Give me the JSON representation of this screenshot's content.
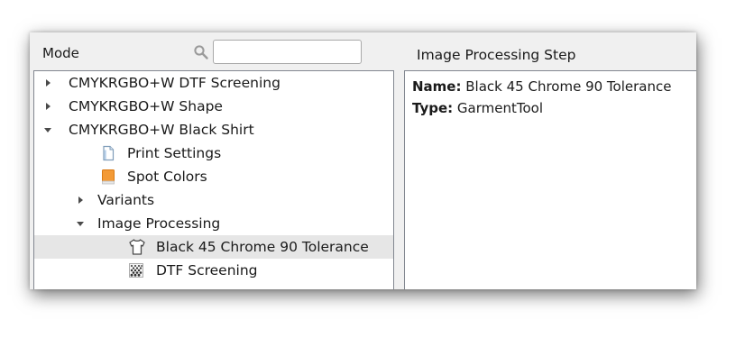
{
  "mode_panel": {
    "label": "Mode",
    "search": {
      "icon": "search-icon",
      "value": "",
      "placeholder": ""
    },
    "tree": [
      {
        "label": "CMYKRGBO+W DTF Screening",
        "level": 0,
        "expander": "collapsed",
        "icon": null
      },
      {
        "label": "CMYKRGBO+W Shape",
        "level": 0,
        "expander": "collapsed",
        "icon": null
      },
      {
        "label": "CMYKRGBO+W Black Shirt",
        "level": 0,
        "expander": "expanded",
        "icon": null
      },
      {
        "label": "Print Settings",
        "level": 1,
        "expander": "none",
        "icon": "document-icon"
      },
      {
        "label": "Spot Colors",
        "level": 1,
        "expander": "none",
        "icon": "spot-color-swatch-icon"
      },
      {
        "label": "Variants",
        "level": 1,
        "expander": "collapsed",
        "icon": null
      },
      {
        "label": "Image Processing",
        "level": 1,
        "expander": "expanded",
        "icon": null
      },
      {
        "label": "Black 45 Chrome 90 Tolerance",
        "level": 2,
        "expander": "none",
        "icon": "tshirt-icon",
        "selected": true
      },
      {
        "label": "DTF Screening",
        "level": 2,
        "expander": "none",
        "icon": "halftone-icon"
      }
    ]
  },
  "details_panel": {
    "title": "Image Processing Step",
    "name_label": "Name:",
    "name_value": "Black 45 Chrome 90 Tolerance",
    "type_label": "Type:",
    "type_value": "GarmentTool"
  },
  "colors": {
    "selection": "#e6e6e6",
    "border": "#828790",
    "window_bg": "#f0f0f0",
    "spot_color_orange": "#f39a36"
  }
}
